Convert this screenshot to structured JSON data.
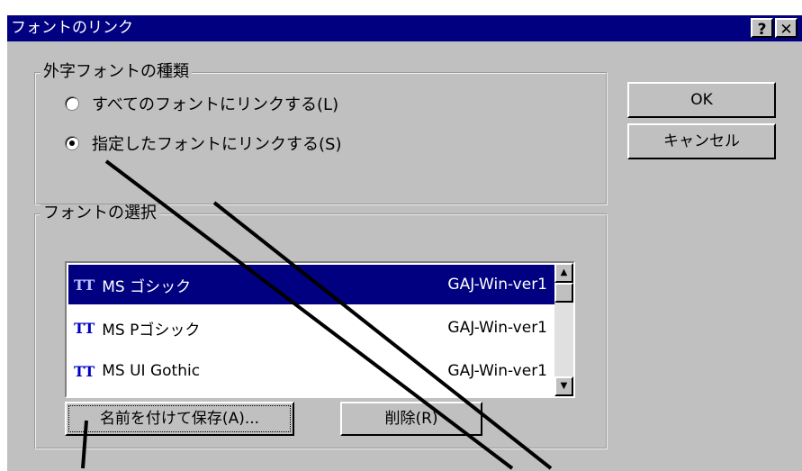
{
  "window": {
    "title": "フォントのリンク",
    "help_label": "?",
    "close_label": "✕"
  },
  "char_group": {
    "label": "外字フォントの種類",
    "options": [
      {
        "label": "すべてのフォントにリンクする(L)",
        "checked": false
      },
      {
        "label": "指定したフォントにリンクする(S)",
        "checked": true
      }
    ]
  },
  "buttons": {
    "ok": "OK",
    "cancel": "キャンセル"
  },
  "font_group": {
    "label": "フォントの選択",
    "fonts": [
      {
        "icon": "truetype-icon",
        "name": "MS ゴシック",
        "encoding": "GAJ-Win-ver1",
        "selected": true
      },
      {
        "icon": "truetype-icon",
        "name": "MS Pゴシック",
        "encoding": "GAJ-Win-ver1",
        "selected": false
      },
      {
        "icon": "truetype-icon",
        "name": "MS UI Gothic",
        "encoding": "GAJ-Win-ver1",
        "selected": false
      }
    ],
    "save_as_label": "名前を付けて保存(A)...",
    "delete_label": "削除(R)"
  },
  "icons": {
    "truetype": "TT",
    "scroll_up": "▲",
    "scroll_down": "▼"
  }
}
